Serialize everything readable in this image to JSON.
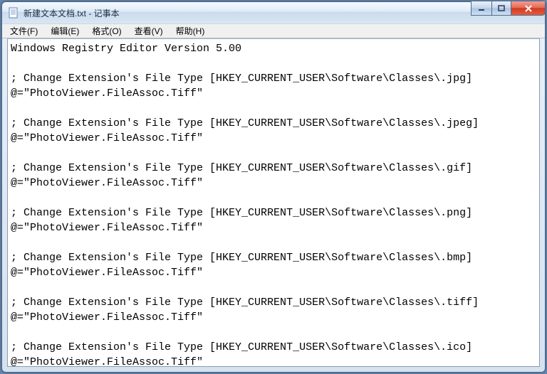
{
  "window": {
    "title": "新建文本文档.txt - 记事本"
  },
  "menu": {
    "file": "文件(F)",
    "edit": "编辑(E)",
    "format": "格式(O)",
    "view": "查看(V)",
    "help": "帮助(H)"
  },
  "document": {
    "text": "Windows Registry Editor Version 5.00\n\n; Change Extension's File Type [HKEY_CURRENT_USER\\Software\\Classes\\.jpg]\n@=\"PhotoViewer.FileAssoc.Tiff\"\n\n; Change Extension's File Type [HKEY_CURRENT_USER\\Software\\Classes\\.jpeg]\n@=\"PhotoViewer.FileAssoc.Tiff\"\n\n; Change Extension's File Type [HKEY_CURRENT_USER\\Software\\Classes\\.gif]\n@=\"PhotoViewer.FileAssoc.Tiff\"\n\n; Change Extension's File Type [HKEY_CURRENT_USER\\Software\\Classes\\.png]\n@=\"PhotoViewer.FileAssoc.Tiff\"\n\n; Change Extension's File Type [HKEY_CURRENT_USER\\Software\\Classes\\.bmp]\n@=\"PhotoViewer.FileAssoc.Tiff\"\n\n; Change Extension's File Type [HKEY_CURRENT_USER\\Software\\Classes\\.tiff]\n@=\"PhotoViewer.FileAssoc.Tiff\"\n\n; Change Extension's File Type [HKEY_CURRENT_USER\\Software\\Classes\\.ico]\n@=\"PhotoViewer.FileAssoc.Tiff\"\n"
  }
}
